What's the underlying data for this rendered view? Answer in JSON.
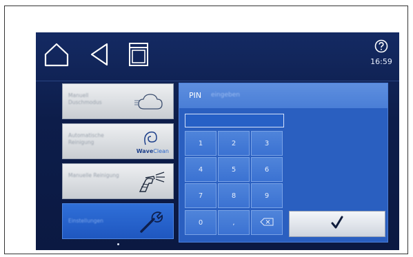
{
  "status": {
    "help_icon": "question-circle-icon",
    "time": "16:59"
  },
  "nav": {
    "home_icon": "home-icon",
    "back_icon": "back-triangle-icon",
    "appliance_icon": "oven-icon"
  },
  "menu": [
    {
      "label": "Manuell Duschmodus",
      "icon": "steam-cloud-icon"
    },
    {
      "label": "Automatische Reinigung",
      "icon": "waveclean-icon",
      "brand_bold": "Wave",
      "brand_light": "Clean"
    },
    {
      "label": "Manuelle Reinigung",
      "icon": "spray-gun-icon"
    },
    {
      "label": "Einstellungen",
      "icon": "wrench-icon"
    }
  ],
  "pin_panel": {
    "title_bold": "PIN",
    "title_rest": "eingeben",
    "input_value": "",
    "keys": [
      "1",
      "2",
      "3",
      "4",
      "5",
      "6",
      "7",
      "8",
      "9",
      "0",
      ","
    ],
    "backspace_icon": "backspace-icon",
    "confirm_icon": "checkmark-icon"
  },
  "colors": {
    "screen_bg": "#0d1d4a",
    "panel_bg": "#2a5fc0",
    "accent": "#2f6fd8",
    "key_bg": "#4f84da"
  }
}
